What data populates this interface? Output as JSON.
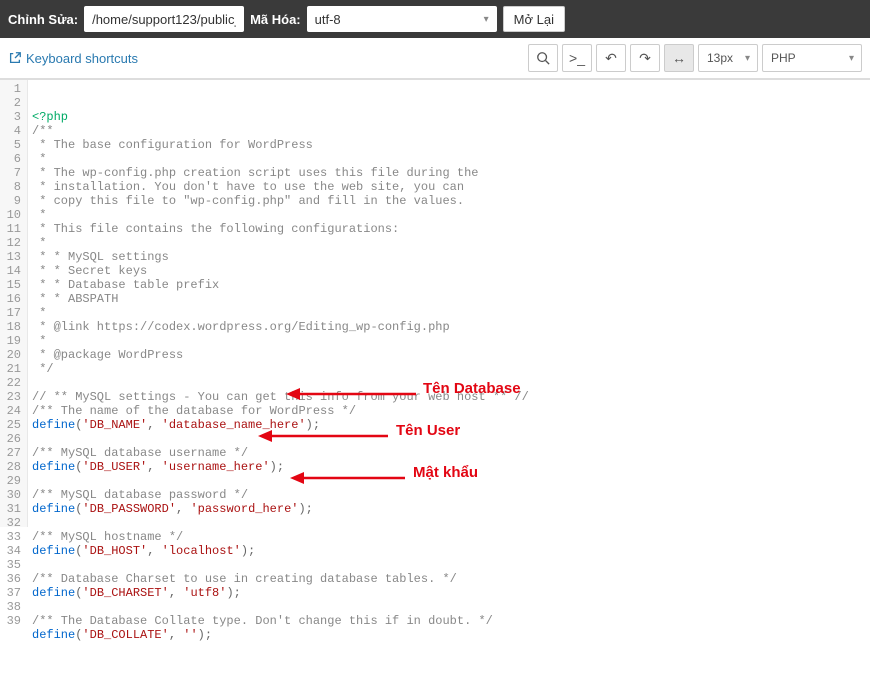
{
  "header": {
    "edit_label": "Chỉnh Sửa:",
    "path_value": "/home/support123/public_",
    "encoding_label": "Mã Hóa:",
    "encoding_value": "utf-8",
    "reopen_label": "Mở Lại"
  },
  "subheader": {
    "kb_shortcuts": "Keyboard shortcuts"
  },
  "toolbar": {
    "font_size": "13px",
    "language": "PHP"
  },
  "annotations": {
    "db_name": "Tên Database",
    "db_user": "Tên User",
    "db_pass": "Mật khẩu"
  },
  "code_lines": [
    {
      "n": 1,
      "t": "<?php",
      "cls": "kw"
    },
    {
      "n": 2,
      "t": "/**",
      "cls": "com"
    },
    {
      "n": 3,
      "t": " * The base configuration for WordPress",
      "cls": "com"
    },
    {
      "n": 4,
      "t": " *",
      "cls": "com"
    },
    {
      "n": 5,
      "t": " * The wp-config.php creation script uses this file during the",
      "cls": "com"
    },
    {
      "n": 6,
      "t": " * installation. You don't have to use the web site, you can",
      "cls": "com"
    },
    {
      "n": 7,
      "t": " * copy this file to \"wp-config.php\" and fill in the values.",
      "cls": "com"
    },
    {
      "n": 8,
      "t": " *",
      "cls": "com"
    },
    {
      "n": 9,
      "t": " * This file contains the following configurations:",
      "cls": "com"
    },
    {
      "n": 10,
      "t": " *",
      "cls": "com"
    },
    {
      "n": 11,
      "t": " * * MySQL settings",
      "cls": "com"
    },
    {
      "n": 12,
      "t": " * * Secret keys",
      "cls": "com"
    },
    {
      "n": 13,
      "t": " * * Database table prefix",
      "cls": "com"
    },
    {
      "n": 14,
      "t": " * * ABSPATH",
      "cls": "com"
    },
    {
      "n": 15,
      "t": " *",
      "cls": "com"
    },
    {
      "n": 16,
      "t": " * @link https://codex.wordpress.org/Editing_wp-config.php",
      "cls": "com"
    },
    {
      "n": 17,
      "t": " *",
      "cls": "com"
    },
    {
      "n": 18,
      "t": " * @package WordPress",
      "cls": "com"
    },
    {
      "n": 19,
      "t": " */",
      "cls": "com"
    },
    {
      "n": 20,
      "t": "",
      "cls": ""
    },
    {
      "n": 21,
      "t": "// ** MySQL settings - You can get this info from your web host ** //",
      "cls": "com"
    },
    {
      "n": 22,
      "t": "/** The name of the database for WordPress */",
      "cls": "com"
    },
    {
      "n": 23,
      "html": "<span class='fn'>define</span>(<span class='str'>'DB_NAME'</span>, <span class='str'>'database_name_here'</span>);"
    },
    {
      "n": 24,
      "t": "",
      "cls": ""
    },
    {
      "n": 25,
      "t": "/** MySQL database username */",
      "cls": "com"
    },
    {
      "n": 26,
      "html": "<span class='fn'>define</span>(<span class='str'>'DB_USER'</span>, <span class='str'>'username_here'</span>);"
    },
    {
      "n": 27,
      "t": "",
      "cls": ""
    },
    {
      "n": 28,
      "t": "/** MySQL database password */",
      "cls": "com"
    },
    {
      "n": 29,
      "html": "<span class='fn'>define</span>(<span class='str'>'DB_PASSWORD'</span>, <span class='str'>'password_here'</span>);"
    },
    {
      "n": 30,
      "t": "",
      "cls": ""
    },
    {
      "n": 31,
      "t": "/** MySQL hostname */",
      "cls": "com"
    },
    {
      "n": 32,
      "html": "<span class='fn'>define</span>(<span class='str'>'DB_HOST'</span>, <span class='str'>'localhost'</span>);"
    },
    {
      "n": 33,
      "t": "",
      "cls": ""
    },
    {
      "n": 34,
      "t": "/** Database Charset to use in creating database tables. */",
      "cls": "com"
    },
    {
      "n": 35,
      "html": "<span class='fn'>define</span>(<span class='str'>'DB_CHARSET'</span>, <span class='str'>'utf8'</span>);"
    },
    {
      "n": 36,
      "t": "",
      "cls": ""
    },
    {
      "n": 37,
      "t": "/** The Database Collate type. Don't change this if in doubt. */",
      "cls": "com"
    },
    {
      "n": 38,
      "html": "<span class='fn'>define</span>(<span class='str'>'DB_COLLATE'</span>, <span class='str'>''</span>);"
    },
    {
      "n": 39,
      "t": "",
      "cls": ""
    }
  ]
}
